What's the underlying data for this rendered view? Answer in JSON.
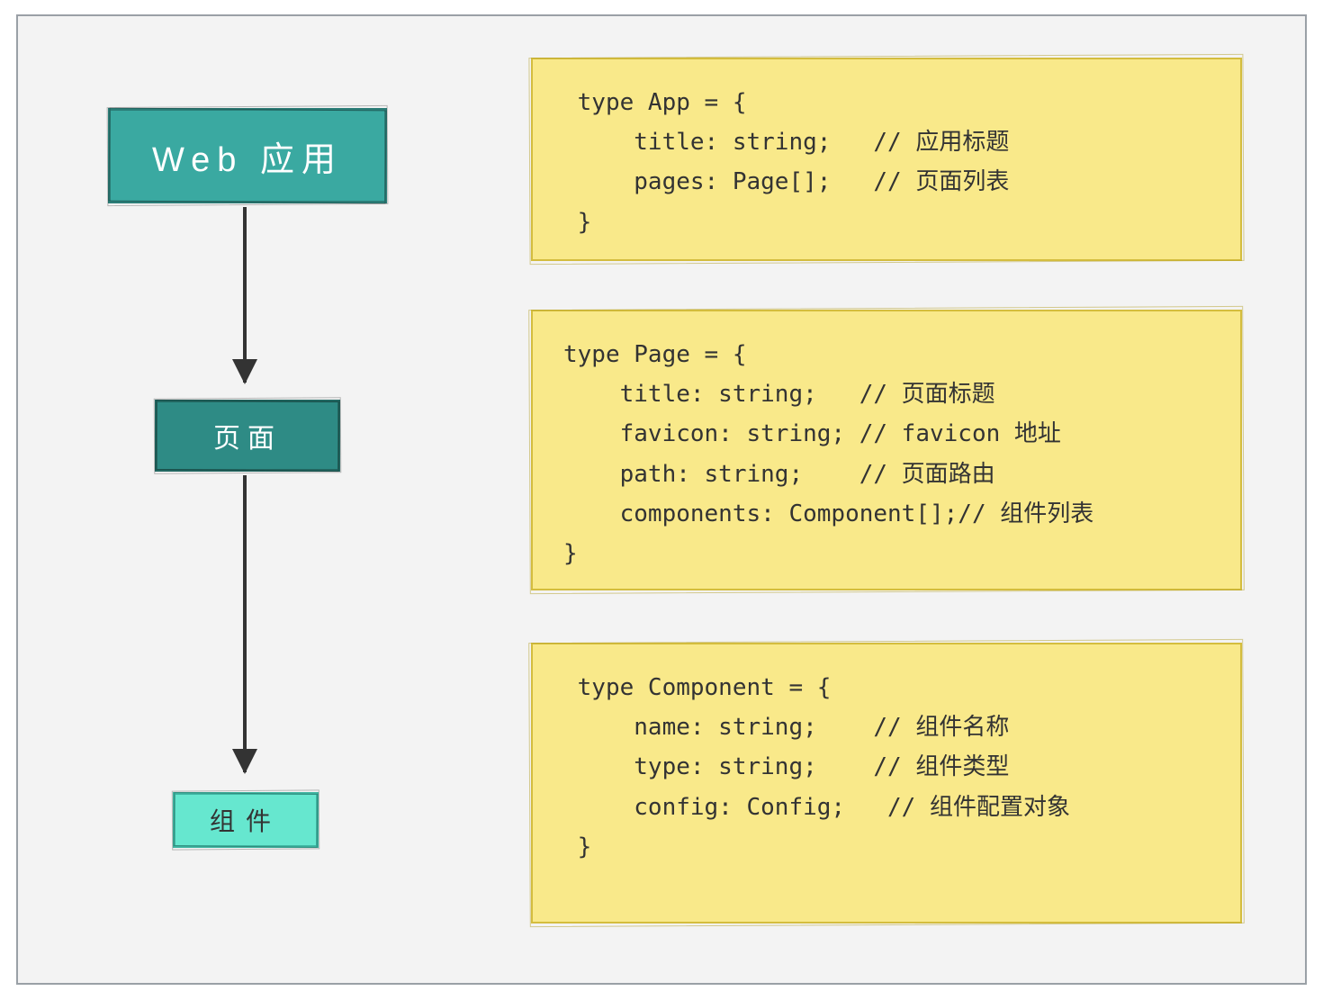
{
  "diagram": {
    "nodes": {
      "app": "Web 应用",
      "page": "页面",
      "component": "组件"
    },
    "code": {
      "app": " type App = {\n     title: string;   // 应用标题\n     pages: Page[];   // 页面列表\n }",
      "page": "type Page = {\n    title: string;   // 页面标题\n    favicon: string; // favicon 地址\n    path: string;    // 页面路由\n    components: Component[];// 组件列表\n}",
      "component": " type Component = {\n     name: string;    // 组件名称\n     type: string;    // 组件类型\n     config: Config;   // 组件配置对象\n }"
    }
  }
}
